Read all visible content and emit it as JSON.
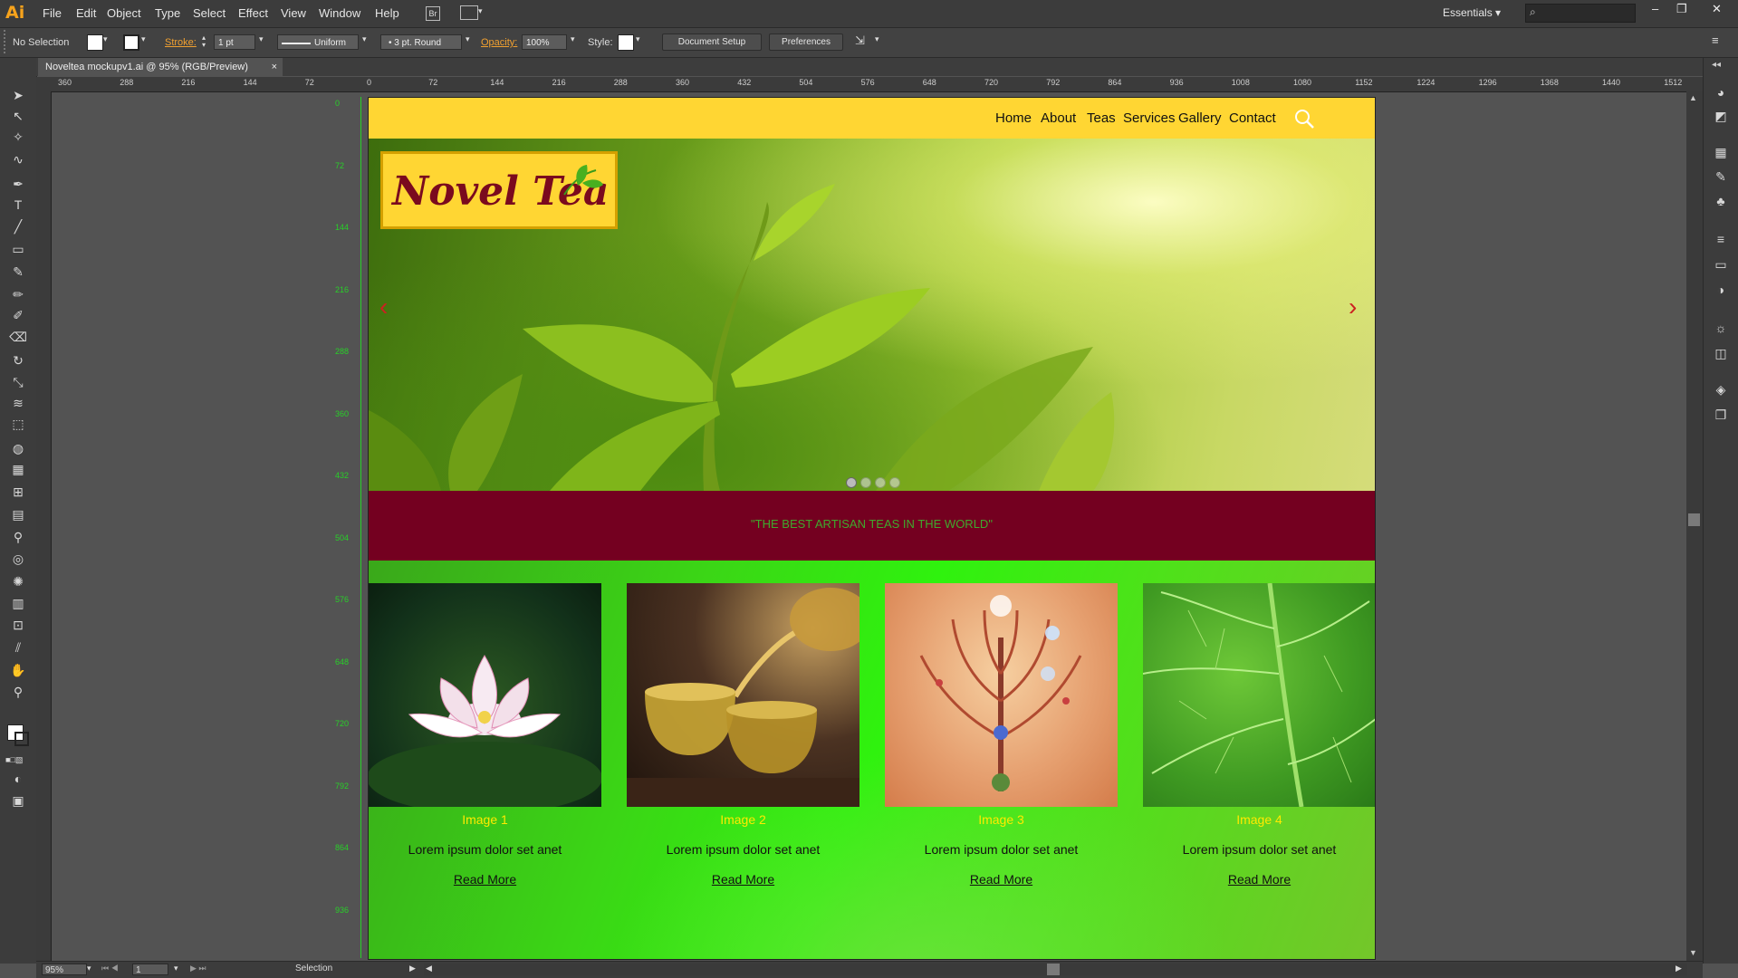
{
  "app": {
    "logo": "Ai",
    "menu": [
      "File",
      "Edit",
      "Object",
      "Type",
      "Select",
      "Effect",
      "View",
      "Window",
      "Help"
    ],
    "workspace": "Essentials",
    "window_controls": [
      "–",
      "❐",
      "✕"
    ]
  },
  "control_bar": {
    "selection": "No Selection",
    "stroke_label": "Stroke:",
    "stroke_value": "1 pt",
    "profile": "Uniform",
    "brush": "3 pt. Round",
    "opacity_label": "Opacity:",
    "opacity_value": "100%",
    "style_label": "Style:",
    "document_setup": "Document Setup",
    "preferences": "Preferences"
  },
  "document_tab": {
    "title": "Noveltea mockupv1.ai @ 95% (RGB/Preview)",
    "close": "×"
  },
  "rulers": {
    "horizontal": [
      "360",
      "288",
      "216",
      "144",
      "72",
      "0",
      "72",
      "144",
      "216",
      "288",
      "360",
      "432",
      "504",
      "576",
      "648",
      "720",
      "792",
      "864",
      "936",
      "1008",
      "1080",
      "1152",
      "1224",
      "1296",
      "1368",
      "1440",
      "1512"
    ],
    "vertical": [
      "0",
      "72",
      "144",
      "216",
      "288",
      "360",
      "432",
      "504",
      "576",
      "648",
      "720",
      "792",
      "864",
      "936"
    ]
  },
  "status_bar": {
    "zoom": "95%",
    "artboard": "1",
    "tool": "Selection"
  },
  "website": {
    "nav": [
      "Home",
      "About",
      "Teas",
      "Services",
      "Gallery",
      "Contact"
    ],
    "logo_text": "Novel Tea",
    "tagline": "\"THE BEST ARTISAN TEAS IN THE WORLD\"",
    "cards": [
      {
        "caption": "Image 1",
        "desc": "Lorem ipsum dolor set anet",
        "link": "Read More"
      },
      {
        "caption": "Image 2",
        "desc": "Lorem ipsum dolor set anet",
        "link": "Read More"
      },
      {
        "caption": "Image 3",
        "desc": "Lorem ipsum dolor set anet",
        "link": "Read More"
      },
      {
        "caption": "Image 4",
        "desc": "Lorem ipsum dolor set anet",
        "link": "Read More"
      }
    ],
    "colors": {
      "nav": "#ffd633",
      "tagline_band": "#740020",
      "tagline_text": "#3fa92d",
      "caption": "#ffea00",
      "logo_text": "#7a0a1e"
    }
  }
}
